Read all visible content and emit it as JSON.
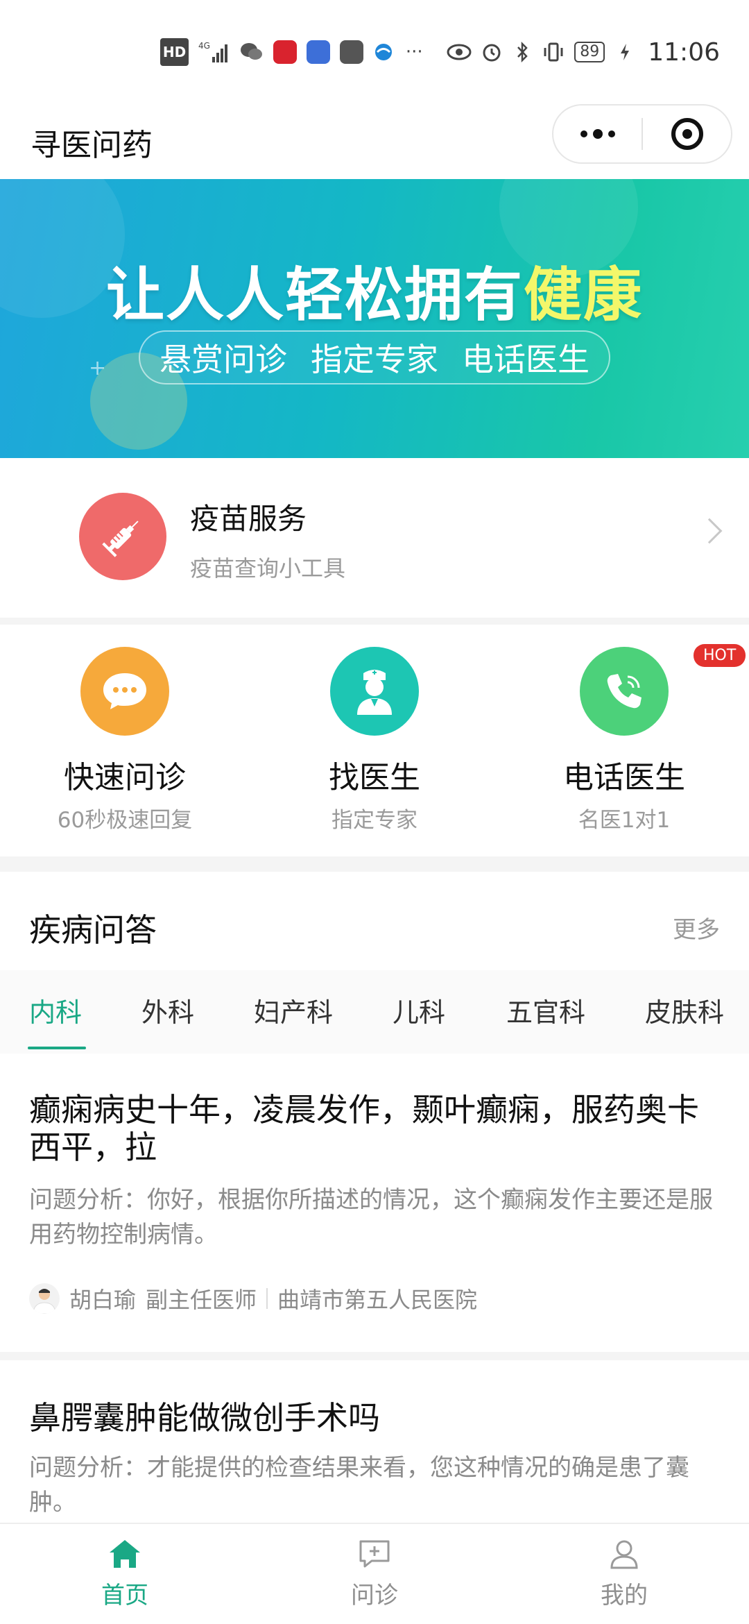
{
  "status_bar": {
    "hd": "HD",
    "network": "4G",
    "battery": "89",
    "time": "11:06",
    "more": "···"
  },
  "header": {
    "title": "寻医问药"
  },
  "banner": {
    "headline_part1": "让人人轻松拥有",
    "headline_highlight": "健康",
    "pill_items": [
      "悬赏问诊",
      "指定专家",
      "电话医生"
    ]
  },
  "vaccine": {
    "title": "疫苗服务",
    "subtitle": "疫苗查询小工具",
    "icon": "syringe-icon",
    "color": "#ef6a6a"
  },
  "services": [
    {
      "label": "快速问诊",
      "sub": "60秒极速回复",
      "icon": "chat-bubble-icon",
      "color": "#f6a93b"
    },
    {
      "label": "找医生",
      "sub": "指定专家",
      "icon": "doctor-icon",
      "color": "#1dc6b3"
    },
    {
      "label": "电话医生",
      "sub": "名医1对1",
      "icon": "phone-icon",
      "color": "#4cd17a",
      "badge": "HOT"
    }
  ],
  "qa": {
    "title": "疾病问答",
    "more": "更多",
    "tabs": [
      "内科",
      "外科",
      "妇产科",
      "儿科",
      "五官科",
      "皮肤科"
    ],
    "active_tab": "内科",
    "articles": [
      {
        "title": "癫痫病史十年，凌晨发作，颞叶癫痫，服药奥卡西平，拉",
        "body": "问题分析：你好，根据你所描述的情况，这个癫痫发作主要还是服用药物控制病情。",
        "doctor": "胡白瑜",
        "doctor_title": "副主任医师",
        "hospital": "曲靖市第五人民医院"
      },
      {
        "title": "鼻腭囊肿能做微创手术吗",
        "body": "问题分析：才能提供的检查结果来看，您这种情况的确是患了囊肿。"
      }
    ]
  },
  "bottom_nav": [
    {
      "label": "首页",
      "icon": "home-icon",
      "active": true
    },
    {
      "label": "问诊",
      "icon": "consult-icon",
      "active": false
    },
    {
      "label": "我的",
      "icon": "profile-icon",
      "active": false
    }
  ],
  "colors": {
    "accent": "#1aa885",
    "hot": "#e3312d"
  }
}
